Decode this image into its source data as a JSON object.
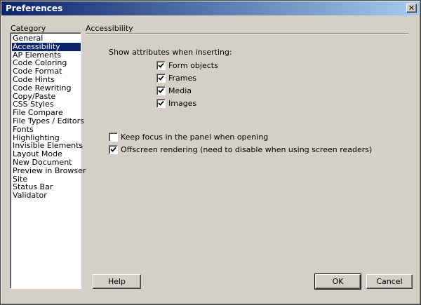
{
  "window": {
    "title": "Preferences",
    "close_symbol": "✕"
  },
  "category": {
    "label": "Category",
    "items": [
      "General",
      "Accessibility",
      "AP Elements",
      "Code Coloring",
      "Code Format",
      "Code Hints",
      "Code Rewriting",
      "Copy/Paste",
      "CSS Styles",
      "File Compare",
      "File Types / Editors",
      "Fonts",
      "Highlighting",
      "Invisible Elements",
      "Layout Mode",
      "New Document",
      "Preview in Browser",
      "Site",
      "Status Bar",
      "Validator"
    ],
    "selected": "Accessibility"
  },
  "panel": {
    "title": "Accessibility",
    "show_attributes_label": "Show attributes when inserting:",
    "attributes": [
      {
        "label": "Form objects",
        "checked": true
      },
      {
        "label": "Frames",
        "checked": true
      },
      {
        "label": "Media",
        "checked": true
      },
      {
        "label": "Images",
        "checked": true
      }
    ],
    "keep_focus": {
      "label": "Keep focus in the panel when opening",
      "checked": false
    },
    "offscreen": {
      "label": "Offscreen rendering (need to disable when using screen readers)",
      "checked": true
    }
  },
  "buttons": {
    "help": "Help",
    "ok": "OK",
    "cancel": "Cancel"
  }
}
